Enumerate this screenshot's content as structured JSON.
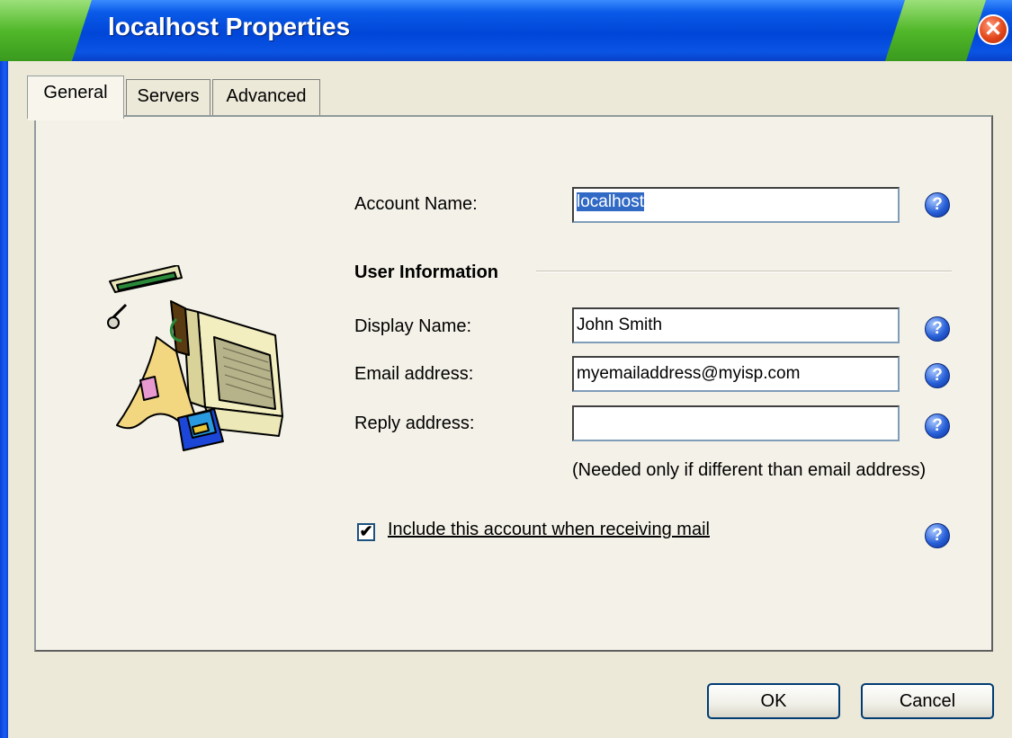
{
  "window": {
    "title": "localhost Properties",
    "close_glyph": "✕"
  },
  "tabs": [
    {
      "label": "General",
      "active": true
    },
    {
      "label": "Servers",
      "active": false
    },
    {
      "label": "Advanced",
      "active": false
    }
  ],
  "account": {
    "label": "Account Name:",
    "value": "localhost"
  },
  "user_info": {
    "section_title": "User Information",
    "display_name_label": "Display Name:",
    "display_name_value": "John Smith",
    "email_label": "Email address:",
    "email_value": "myemailaddress@myisp.com",
    "reply_label": "Reply address:",
    "reply_value": "",
    "reply_hint": "(Needed only if different than email address)"
  },
  "include": {
    "checked": true,
    "check_glyph": "✔",
    "label": "Include this account when receiving mail"
  },
  "help_glyph": "?",
  "buttons": {
    "ok": "OK",
    "cancel": "Cancel"
  },
  "icons": {
    "illustration": "computer-with-disk-illustration",
    "help": "help-icon",
    "close": "close-icon"
  },
  "colors": {
    "titlebar_blue": "#0046d8",
    "selection": "#316ac5",
    "dialog_bg": "#ece9d8"
  }
}
